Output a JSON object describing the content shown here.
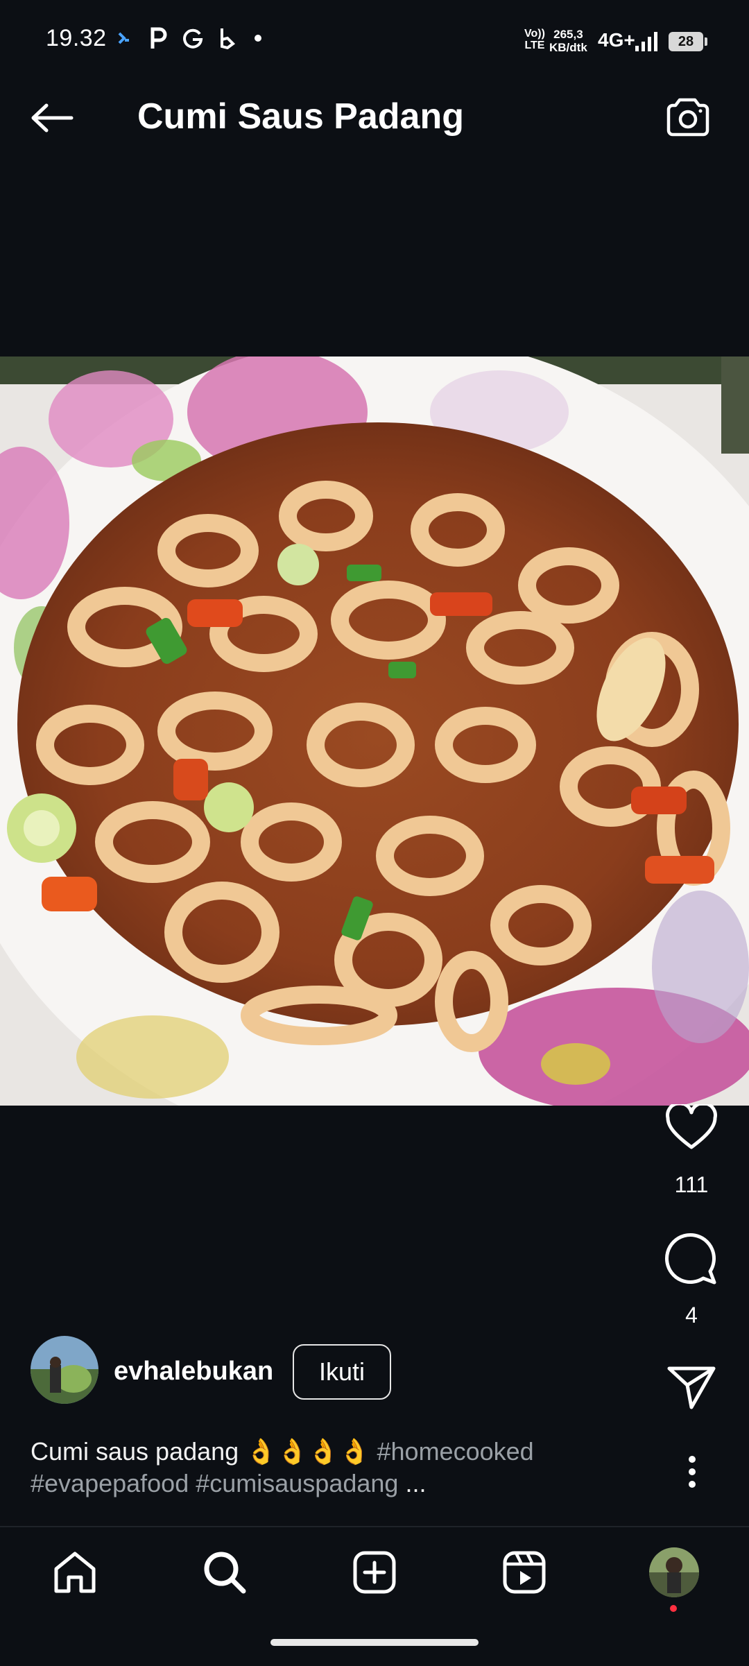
{
  "status_bar": {
    "time": "19.32",
    "network": "Vo)) LTE",
    "network_line1": "Vo))",
    "network_line2": "LTE",
    "speed_line1": "265,3",
    "speed_line2": "KB/dtk",
    "signal": "4G+",
    "battery": "28",
    "icons": [
      "app-notification-icon",
      "p-icon",
      "g-icon",
      "b-icon",
      "dot-icon",
      "signal-bars-icon",
      "battery-icon"
    ]
  },
  "header": {
    "title": "Cumi Saus Padang",
    "back_icon": "arrow-left-icon",
    "camera_icon": "camera-icon"
  },
  "post": {
    "likes": "111",
    "comments": "4",
    "username": "evhalebukan",
    "follow_label": "Ikuti",
    "caption_text": "Cumi saus padang 👌👌👌👌",
    "caption_tags_1": "#homecooked",
    "caption_tags_2": "#evapepafood #cumisauspadang",
    "caption_more": "..."
  },
  "nav": {
    "items": [
      "home-icon",
      "search-icon",
      "create-icon",
      "reels-icon",
      "profile-avatar"
    ]
  },
  "colors": {
    "background": "#0c0f14",
    "text": "#ffffff",
    "hashtag": "#9aa0a6",
    "notification_dot": "#ff3040"
  }
}
